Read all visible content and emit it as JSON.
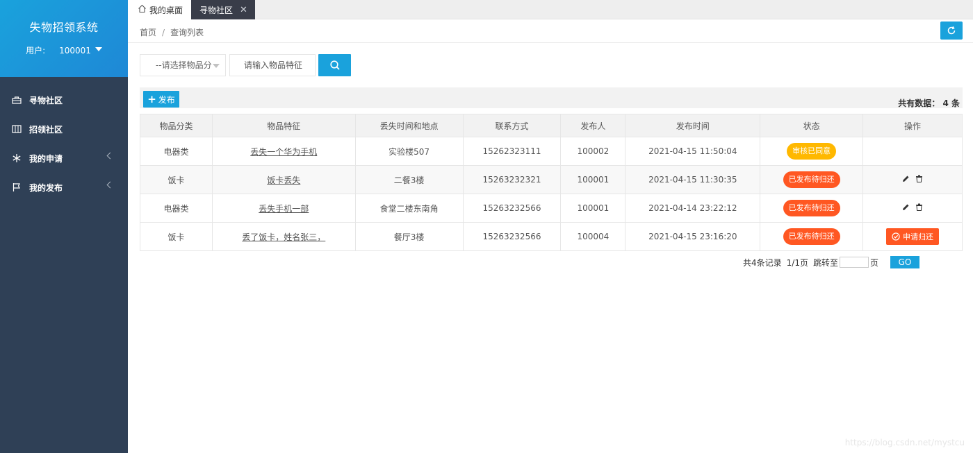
{
  "sidebar": {
    "title": "失物招领系统",
    "user_label": "用户:",
    "user_id": "100001",
    "items": [
      {
        "label": "寻物社区",
        "icon": "briefcase-icon"
      },
      {
        "label": "招领社区",
        "icon": "columns-icon"
      },
      {
        "label": "我的申请",
        "icon": "snowflake-icon"
      },
      {
        "label": "我的发布",
        "icon": "flag-icon"
      }
    ]
  },
  "tabs": [
    {
      "label": "我的桌面",
      "icon": "home-icon"
    },
    {
      "label": "寻物社区",
      "active": true
    }
  ],
  "breadcrumb": {
    "home": "首页",
    "current": "查询列表"
  },
  "search": {
    "category_placeholder": "--请选择物品分",
    "keyword_placeholder": "请输入物品特征"
  },
  "toolbar": {
    "publish_label": "发布",
    "total_text": "共有数据： 4 条"
  },
  "table": {
    "columns": [
      "物品分类",
      "物品特征",
      "丢失时间和地点",
      "联系方式",
      "发布人",
      "发布时间",
      "状态",
      "操作"
    ],
    "rows": [
      {
        "category": "电器类",
        "feature": "丢失一个华为手机",
        "place": "实验楼507",
        "contact": "15262323111",
        "publisher": "100002",
        "time": "2021-04-15 11:50:04",
        "status": "审核已同意",
        "op": ""
      },
      {
        "category": "饭卡",
        "feature": "饭卡丢失",
        "place": "二餐3楼",
        "contact": "15263232321",
        "publisher": "100001",
        "time": "2021-04-15 11:30:35",
        "status": "已发布待归还",
        "op": "edit-delete"
      },
      {
        "category": "电器类",
        "feature": "丢失手机一部",
        "place": "食堂二楼东南角",
        "contact": "15263232566",
        "publisher": "100001",
        "time": "2021-04-14 23:22:12",
        "status": "已发布待归还",
        "op": "edit-delete"
      },
      {
        "category": "饭卡",
        "feature": "丢了饭卡，姓名张三，",
        "place": "餐厅3楼",
        "contact": "15263232566",
        "publisher": "100004",
        "time": "2021-04-15 23:16:20",
        "status": "已发布待归还",
        "op": "申请归还"
      }
    ]
  },
  "pager": {
    "records": "共4条记录",
    "pages": "1/1页",
    "jump_label": "跳转至",
    "page_unit": "页",
    "go_label": "GO"
  },
  "watermark": "https://blog.csdn.net/mystcu",
  "colors": {
    "primary": "#1aa2dc",
    "sidebar": "#2f4056",
    "danger": "#ff5722",
    "warning": "#ffb800"
  }
}
